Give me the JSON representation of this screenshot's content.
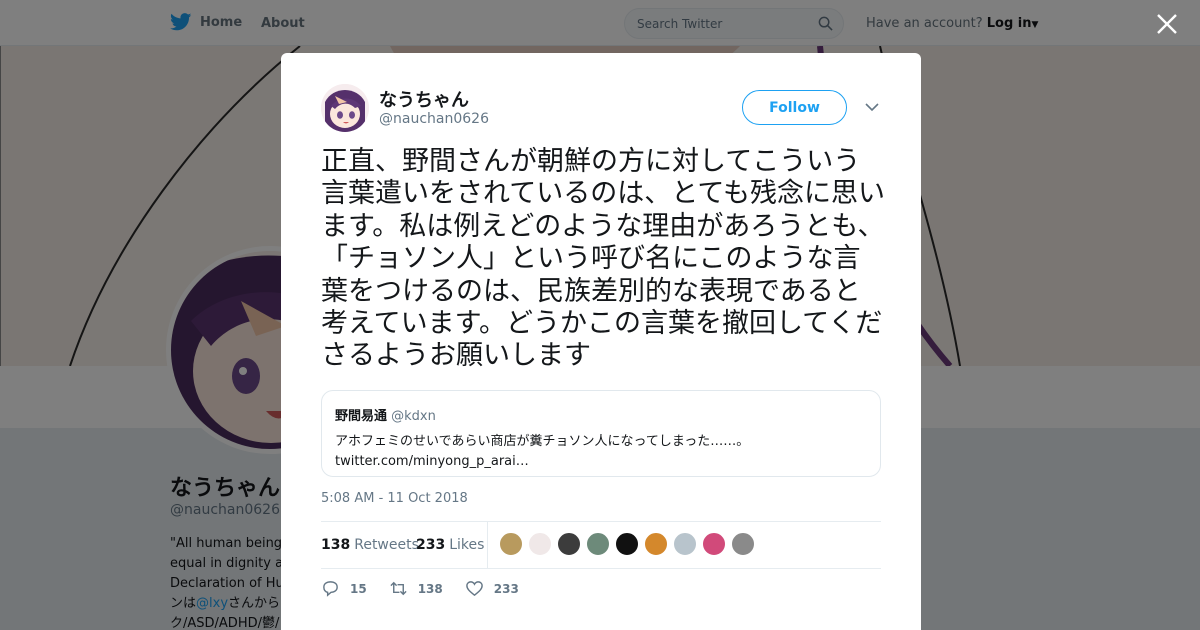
{
  "topbar": {
    "home_label": "Home",
    "about_label": "About",
    "search_placeholder": "Search Twitter",
    "account_prompt": "Have an account?",
    "login_label": "Log in"
  },
  "profile": {
    "name": "なうちゃん",
    "handle": "@nauchan0626",
    "bio_lines": [
      "\"All human beings",
      "equal in dignity an",
      "Declaration of Hur",
      "ンは",
      "ク/ASD/ADHD/鬱/"
    ],
    "bio_link": "@lxy",
    "bio_link_suffix": "さんから"
  },
  "tweet": {
    "author_name": "なうちゃん",
    "author_handle": "@nauchan0626",
    "follow_label": "Follow",
    "text": "正直、野間さんが朝鮮の方に対してこういう言葉遣いをされているのは、とても残念に思います。私は例えどのような理由があろうとも、「チョソン人」という呼び名にこのような言葉をつけるのは、民族差別的な表現であると考えています。どうかこの言葉を撤回してくださるようお願いします",
    "quoted": {
      "name": "野間易通",
      "handle": "@kdxn",
      "text": "アホフェミのせいであらい商店が糞チョソン人になってしまった……。",
      "link": "twitter.com/minyong_p_arai…"
    },
    "timestamp": "5:08 AM - 11 Oct 2018",
    "retweets_count": "138",
    "retweets_label": "Retweets",
    "likes_count": "233",
    "likes_label": "Likes",
    "liker_colors": [
      "#b89a5e",
      "#f0e8e8",
      "#3c3c3c",
      "#6d8a7a",
      "#111111",
      "#d4882c",
      "#b8c4cc",
      "#d14a7a",
      "#8a8a8a"
    ],
    "actions": {
      "reply_count": "15",
      "retweet_count": "138",
      "like_count": "233"
    }
  },
  "colors": {
    "accent": "#1da1f2",
    "muted": "#657786"
  }
}
